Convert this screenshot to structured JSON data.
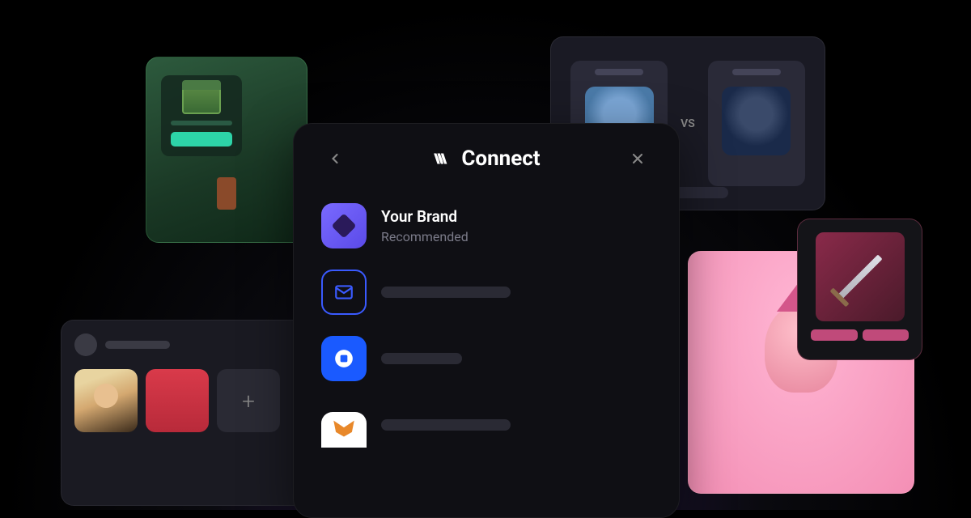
{
  "modal": {
    "title": "Connect",
    "wallets": [
      {
        "name": "Your Brand",
        "subtitle": "Recommended",
        "icon": "brand"
      },
      {
        "name": "",
        "subtitle": "",
        "icon": "email"
      },
      {
        "name": "",
        "subtitle": "",
        "icon": "coinbase"
      },
      {
        "name": "",
        "subtitle": "",
        "icon": "metamask"
      }
    ]
  },
  "vs_card": {
    "label": "VS"
  },
  "profile_card": {
    "add_label": "+"
  }
}
